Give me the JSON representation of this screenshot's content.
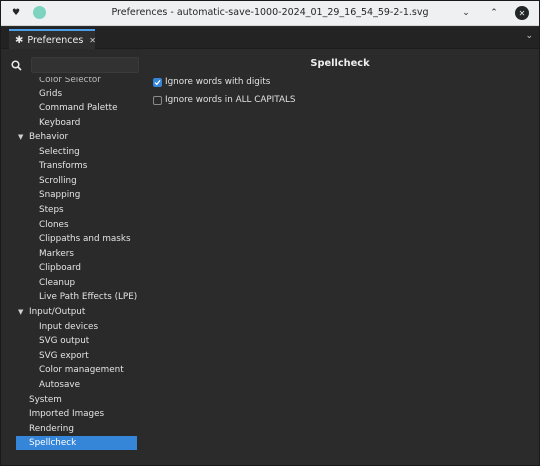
{
  "window": {
    "title": "Preferences - automatic-save-1000-2024_01_29_16_54_59-2-1.svg",
    "pin_glyph": "♥",
    "controls": {
      "minimize": "⌄",
      "maximize": "⌃",
      "close": "✕"
    }
  },
  "tabbar": {
    "tab_label": "Preferences",
    "tab_icon": "✱",
    "tab_close": "✕",
    "dropdown": "⌄"
  },
  "search": {
    "value": "",
    "placeholder": ""
  },
  "tree": {
    "color_selector": "Color Selector",
    "grids": "Grids",
    "command_palette": "Command Palette",
    "keyboard": "Keyboard",
    "behavior": "Behavior",
    "selecting": "Selecting",
    "transforms": "Transforms",
    "scrolling": "Scrolling",
    "snapping": "Snapping",
    "steps": "Steps",
    "clones": "Clones",
    "clippaths": "Clippaths and masks",
    "markers": "Markers",
    "clipboard": "Clipboard",
    "cleanup": "Cleanup",
    "lpe": "Live Path Effects (LPE)",
    "input_output": "Input/Output",
    "input_devices": "Input devices",
    "svg_output": "SVG output",
    "svg_export": "SVG export",
    "color_management": "Color management",
    "autosave": "Autosave",
    "system": "System",
    "imported_images": "Imported Images",
    "rendering": "Rendering",
    "spellcheck": "Spellcheck",
    "expand_arrow": "▼"
  },
  "main": {
    "title": "Spellcheck",
    "options": [
      {
        "label": "Ignore words with digits",
        "checked": true
      },
      {
        "label": "Ignore words in ALL CAPITALS",
        "checked": false
      }
    ]
  },
  "colors": {
    "accent": "#3585d9",
    "background": "#2b2b2b",
    "titlebar": "#eff0f1"
  }
}
